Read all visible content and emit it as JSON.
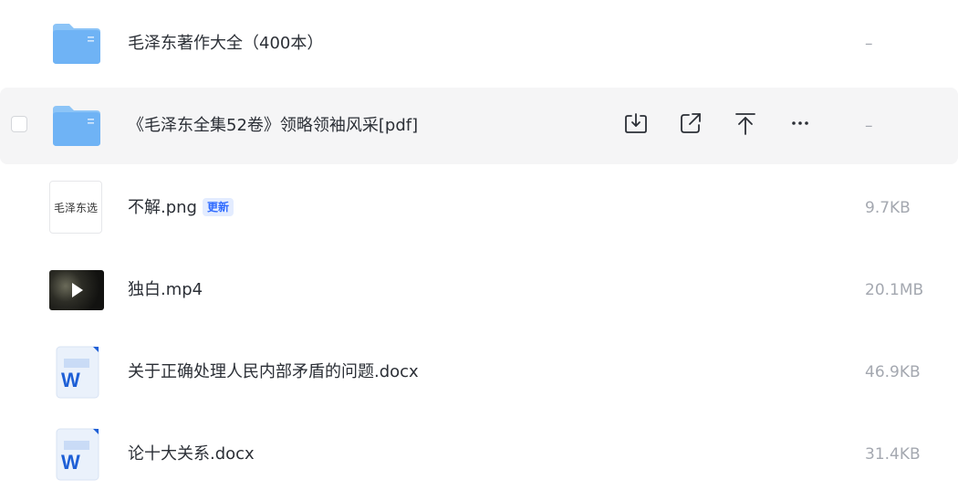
{
  "colors": {
    "folder": "#6fb3f5",
    "hover_row": "#f5f5f6",
    "badge_text": "#2f6bff",
    "badge_bg": "#e3ecff",
    "word_blue": "#1e5fd6",
    "size_text": "#a4a8b0"
  },
  "files": [
    {
      "name": "毛泽东著作大全（400本）",
      "size": "–",
      "type": "folder",
      "icon": "folder-icon"
    },
    {
      "name": "《毛泽东全集52卷》领略领袖风采[pdf]",
      "size": "–",
      "type": "folder",
      "icon": "folder-icon",
      "hovered": true,
      "actions": [
        "download-icon",
        "share-icon",
        "move-to-top-icon",
        "more-icon"
      ]
    },
    {
      "name": "不解.png",
      "size": "9.7KB",
      "type": "image",
      "icon": "image-thumbnail",
      "thumb_text": "毛泽东选",
      "badge": "更新"
    },
    {
      "name": "独白.mp4",
      "size": "20.1MB",
      "type": "video",
      "icon": "video-thumbnail"
    },
    {
      "name": "关于正确处理人民内部矛盾的问题.docx",
      "size": "46.9KB",
      "type": "docx",
      "icon": "word-doc-icon",
      "icon_letter": "W"
    },
    {
      "name": "论十大关系.docx",
      "size": "31.4KB",
      "type": "docx",
      "icon": "word-doc-icon",
      "icon_letter": "W"
    }
  ]
}
